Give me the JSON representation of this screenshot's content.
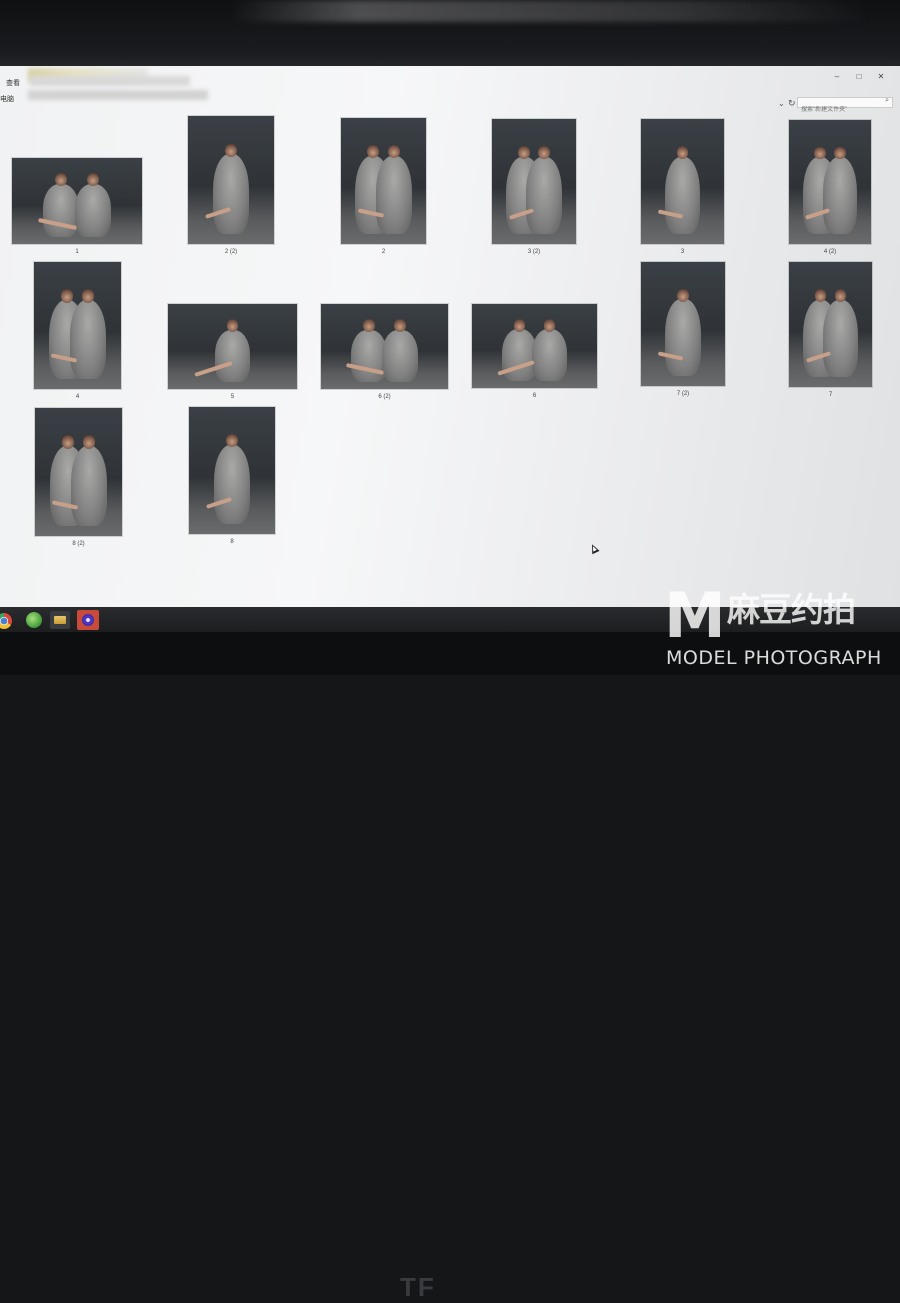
{
  "window": {
    "menu_label": "查看",
    "address_label": "电脑",
    "controls": {
      "minimize": "–",
      "maximize": "□",
      "close": "✕"
    }
  },
  "search": {
    "placeholder": "搜索\"新建文件夹\""
  },
  "files": [
    {
      "name": "1",
      "orientation": "landscape"
    },
    {
      "name": "2 (2)",
      "orientation": "portrait"
    },
    {
      "name": "2",
      "orientation": "portrait"
    },
    {
      "name": "3 (2)",
      "orientation": "portrait"
    },
    {
      "name": "3",
      "orientation": "portrait"
    },
    {
      "name": "4 (2)",
      "orientation": "portrait"
    },
    {
      "name": "4",
      "orientation": "portrait"
    },
    {
      "name": "5",
      "orientation": "landscape"
    },
    {
      "name": "6 (2)",
      "orientation": "landscape"
    },
    {
      "name": "6",
      "orientation": "landscape"
    },
    {
      "name": "7 (2)",
      "orientation": "portrait"
    },
    {
      "name": "7",
      "orientation": "portrait"
    },
    {
      "name": "8 (2)",
      "orientation": "portrait"
    },
    {
      "name": "8",
      "orientation": "portrait"
    }
  ],
  "taskbar": {
    "items": [
      "chrome-icon",
      "ie-icon",
      "folder-icon",
      "app-icon"
    ]
  },
  "watermark": {
    "mark": "M",
    "chinese": "麻豆约拍",
    "english": "MODEL PHOTOGRAPH"
  },
  "bezel": {
    "logo": "TF"
  }
}
